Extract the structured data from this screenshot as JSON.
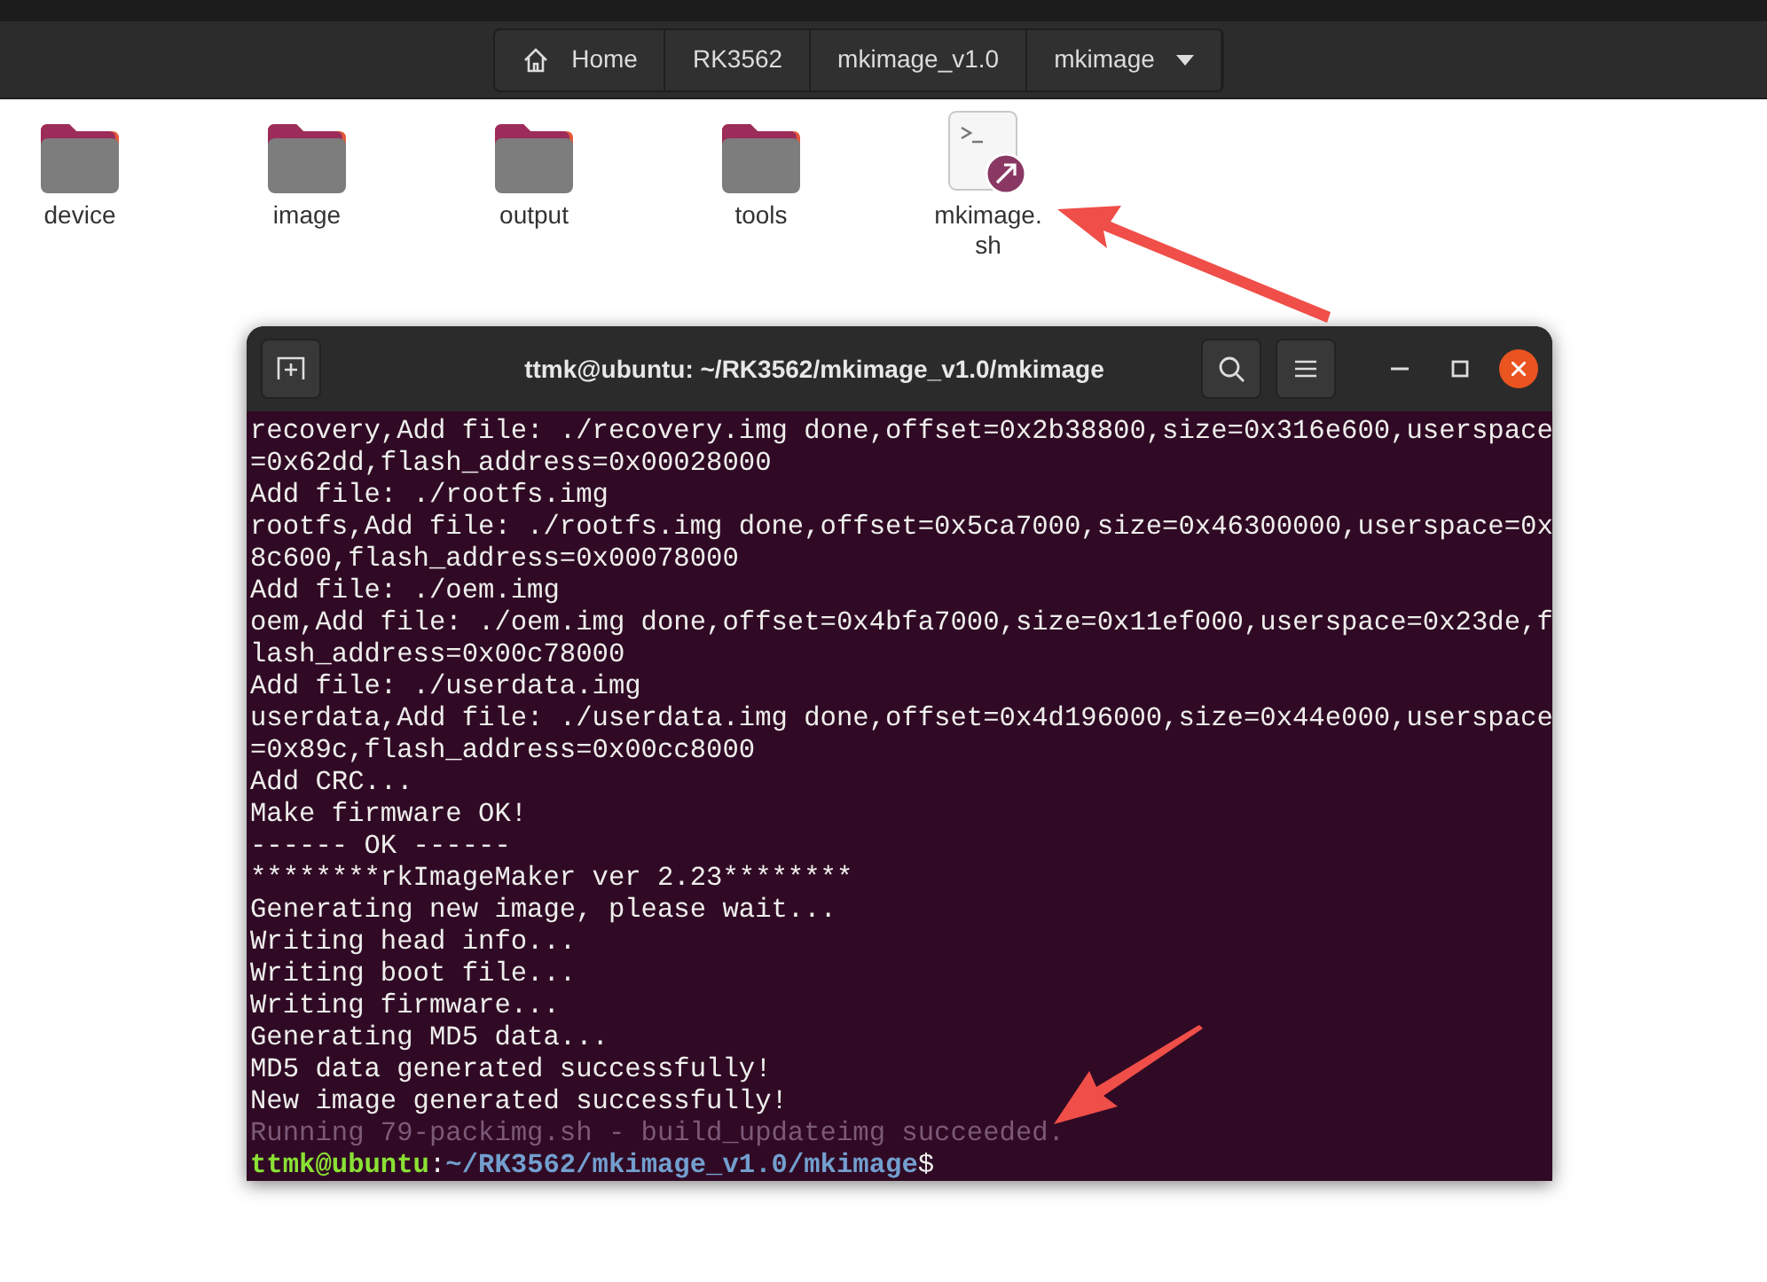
{
  "breadcrumb": [
    {
      "label": "Home",
      "kind": "home"
    },
    {
      "label": "RK3562",
      "kind": "plain"
    },
    {
      "label": "mkimage_v1.0",
      "kind": "plain"
    },
    {
      "label": "mkimage",
      "kind": "dropdown"
    }
  ],
  "files": [
    {
      "name": "device",
      "kind": "folder"
    },
    {
      "name": "image",
      "kind": "folder"
    },
    {
      "name": "output",
      "kind": "folder"
    },
    {
      "name": "tools",
      "kind": "folder"
    },
    {
      "name": "mkimage.sh",
      "kind": "script"
    }
  ],
  "terminal": {
    "title": "ttmk@ubuntu: ~/RK3562/mkimage_v1.0/mkimage",
    "lines": [
      {
        "kind": "output",
        "text": "recovery,Add file: ./recovery.img done,offset=0x2b38800,size=0x316e600,userspace"
      },
      {
        "kind": "output",
        "text": "=0x62dd,flash_address=0x00028000"
      },
      {
        "kind": "output",
        "text": "Add file: ./rootfs.img"
      },
      {
        "kind": "output",
        "text": "rootfs,Add file: ./rootfs.img done,offset=0x5ca7000,size=0x46300000,userspace=0x"
      },
      {
        "kind": "output",
        "text": "8c600,flash_address=0x00078000"
      },
      {
        "kind": "output",
        "text": "Add file: ./oem.img"
      },
      {
        "kind": "output",
        "text": "oem,Add file: ./oem.img done,offset=0x4bfa7000,size=0x11ef000,userspace=0x23de,f"
      },
      {
        "kind": "output",
        "text": "lash_address=0x00c78000"
      },
      {
        "kind": "output",
        "text": "Add file: ./userdata.img"
      },
      {
        "kind": "output",
        "text": "userdata,Add file: ./userdata.img done,offset=0x4d196000,size=0x44e000,userspace"
      },
      {
        "kind": "output",
        "text": "=0x89c,flash_address=0x00cc8000"
      },
      {
        "kind": "output",
        "text": "Add CRC..."
      },
      {
        "kind": "output",
        "text": "Make firmware OK!"
      },
      {
        "kind": "output",
        "text": "------ OK ------"
      },
      {
        "kind": "output",
        "text": "********rkImageMaker ver 2.23********"
      },
      {
        "kind": "output",
        "text": "Generating new image, please wait..."
      },
      {
        "kind": "output",
        "text": "Writing head info..."
      },
      {
        "kind": "output",
        "text": "Writing boot file..."
      },
      {
        "kind": "output",
        "text": "Writing firmware..."
      },
      {
        "kind": "output",
        "text": "Generating MD5 data..."
      },
      {
        "kind": "output",
        "text": "MD5 data generated successfully!"
      },
      {
        "kind": "output",
        "text": "New image generated successfully!"
      },
      {
        "kind": "dim",
        "text": "Running 79-packimg.sh - build_updateimg succeeded."
      }
    ],
    "prompt": {
      "user": "ttmk@ubuntu",
      "separator": ":",
      "path": "~/RK3562/mkimage_v1.0/mkimage",
      "symbol": "$"
    }
  }
}
